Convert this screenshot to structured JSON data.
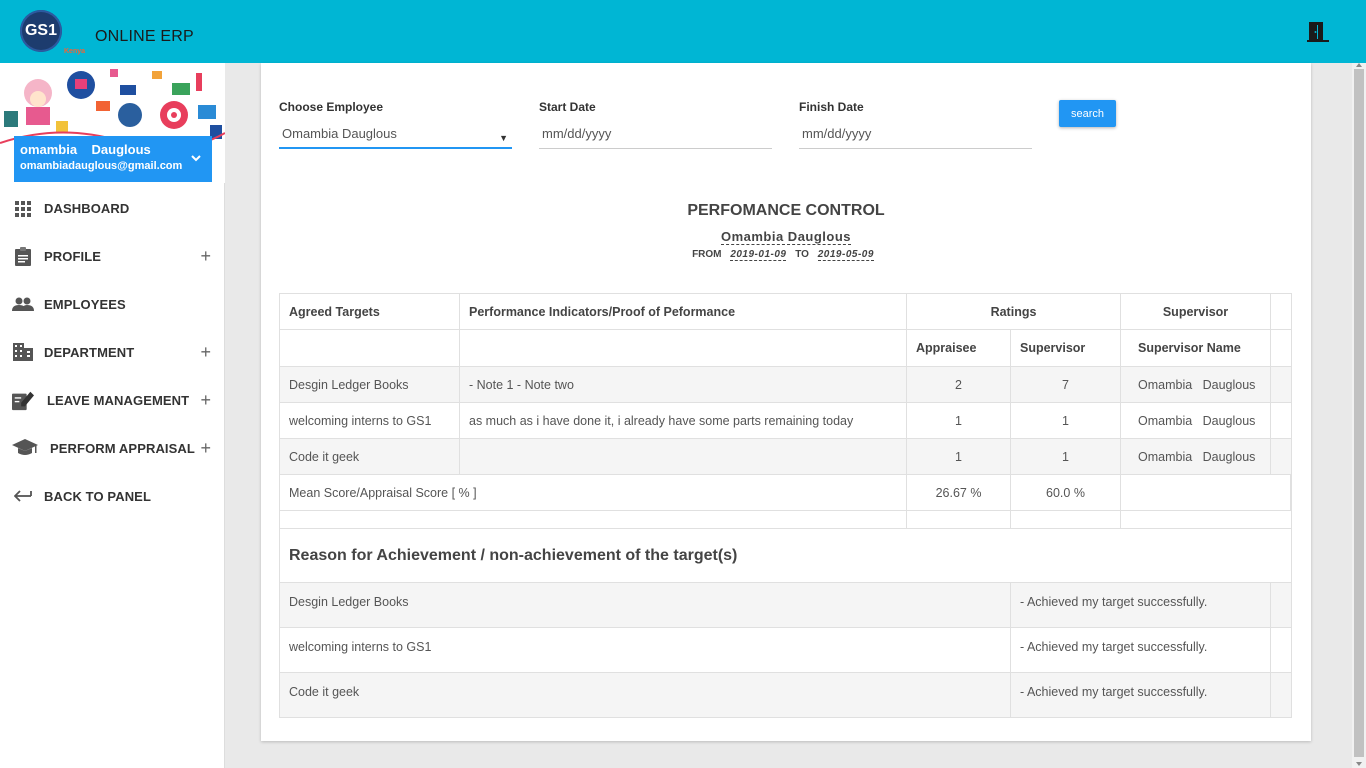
{
  "header": {
    "logo_text": "GS1",
    "logo_sub": "Kenya",
    "app_title": "ONLINE ERP",
    "exit_icon": "exit-door-icon"
  },
  "user": {
    "name": "omambia    Dauglous",
    "email": "omambiadauglous@gmail.com"
  },
  "menu": [
    {
      "label": "DASHBOARD",
      "icon": "grid-icon",
      "expandable": false
    },
    {
      "label": "PROFILE",
      "icon": "clipboard-icon",
      "expandable": true
    },
    {
      "label": "EMPLOYEES",
      "icon": "people-icon",
      "expandable": false
    },
    {
      "label": "DEPARTMENT",
      "icon": "building-icon",
      "expandable": true
    },
    {
      "label": "LEAVE MANAGEMENT",
      "icon": "edit-document-icon",
      "expandable": true
    },
    {
      "label": "PERFORM APPRAISAL",
      "icon": "graduation-cap-icon",
      "expandable": true
    },
    {
      "label": "BACK TO PANEL",
      "icon": "back-arrow-icon",
      "expandable": false
    }
  ],
  "filters": {
    "employee_label": "Choose Employee",
    "employee_value": "Omambia Dauglous",
    "start_label": "Start Date",
    "start_placeholder": "mm/dd/yyyy",
    "finish_label": "Finish Date",
    "finish_placeholder": "mm/dd/yyyy",
    "search_label": "search"
  },
  "report": {
    "title": "PERFOMANCE CONTROL",
    "employee": "Omambia Dauglous",
    "from_label": "FROM",
    "from_date": "2019-01-09",
    "to_label": "TO",
    "to_date": "2019-05-09"
  },
  "table": {
    "headers": {
      "targets": "Agreed Targets",
      "indicators": "Performance Indicators/Proof of Peformance",
      "ratings": "Ratings",
      "supervisor": "Supervisor",
      "appraisee": "Appraisee",
      "supervisor_rating": "Supervisor",
      "supervisor_name": "Supervisor Name"
    },
    "rows": [
      {
        "target": "Desgin Ledger Books",
        "indicator": "- Note 1 - Note two",
        "appraisee": "2",
        "supervisor": "7",
        "supervisor_name": "Omambia   Dauglous"
      },
      {
        "target": "welcoming interns to GS1",
        "indicator": "as much as i have done it, i already have some parts remaining today",
        "appraisee": "1",
        "supervisor": "1",
        "supervisor_name": "Omambia   Dauglous"
      },
      {
        "target": "Code it geek",
        "indicator": "",
        "appraisee": "1",
        "supervisor": "1",
        "supervisor_name": "Omambia   Dauglous"
      }
    ],
    "mean": {
      "label": "Mean Score/Appraisal Score [ % ]",
      "appraisee": "26.67 %",
      "supervisor": "60.0 %"
    }
  },
  "reasons": {
    "title": "Reason for Achievement / non-achievement of the target(s)",
    "rows": [
      {
        "target": "Desgin Ledger Books",
        "reason": "- Achieved my target successfully."
      },
      {
        "target": "welcoming interns to GS1",
        "reason": "- Achieved my target successfully."
      },
      {
        "target": "Code it geek",
        "reason": "- Achieved my target successfully."
      }
    ]
  },
  "colors": {
    "topbar": "#00b6d4",
    "accent": "#2196f3"
  }
}
